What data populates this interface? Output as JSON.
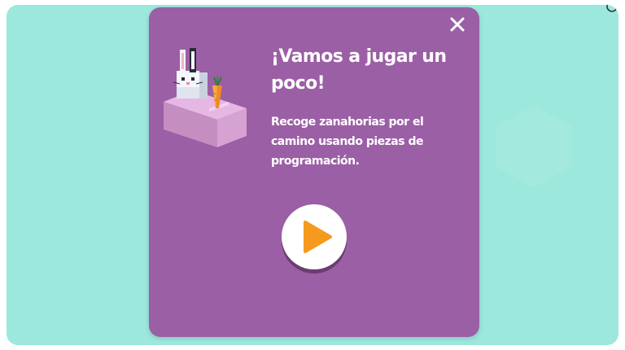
{
  "colors": {
    "background": "#9ce8dc",
    "modal": "#9b5fa5",
    "play_icon": "#f59a1f",
    "text": "#ffffff"
  },
  "modal": {
    "title": "¡Vamos a jugar un poco!",
    "description": "Recoge zanahorias por el camino usando piezas de programación."
  },
  "icons": {
    "close": "close-icon",
    "play": "play-icon",
    "corner": "corner-icon"
  }
}
